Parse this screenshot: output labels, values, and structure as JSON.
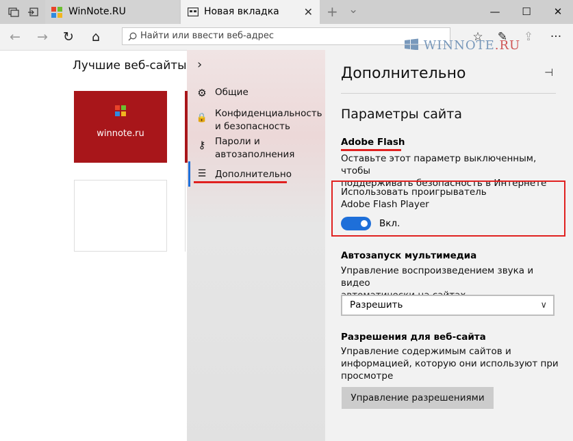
{
  "tabs": [
    {
      "title": "WinNote.RU",
      "close": "✕"
    },
    {
      "title": "Новая вкладка",
      "close": "✕"
    }
  ],
  "tabbar": {
    "new_tab": "+",
    "tab_list": "⌄"
  },
  "window": {
    "minimize": "—",
    "maximize": "☐",
    "close": "✕"
  },
  "toolbar": {
    "back": "←",
    "forward": "→",
    "refresh": "↻",
    "home": "⌂",
    "address_placeholder": "Найти или ввести веб-адрес",
    "favorites": "☆",
    "notes": "✎",
    "share": "⇪",
    "more": "···"
  },
  "watermark": {
    "main": "WINNOTE",
    "suffix": ".RU"
  },
  "top_sites": {
    "title": "Лучшие веб-сайты",
    "tiles": [
      {
        "name": "winnote.ru"
      }
    ],
    "accent": "#a8161a"
  },
  "settings_menu": {
    "chevron": "›",
    "items": [
      {
        "icon": "⚙",
        "label": "Общие"
      },
      {
        "icon": "🔒",
        "label": "Конфиденциальность и безопасность"
      },
      {
        "icon": "⚷",
        "label": "Пароли и автозаполнения"
      },
      {
        "icon": "☰",
        "label": "Дополнительно"
      }
    ]
  },
  "panel": {
    "title": "Дополнительно",
    "pin": "⊣",
    "section_title": "Параметры сайта",
    "flash": {
      "heading": "Adobe Flash",
      "desc_line1": "Оставьте этот параметр выключенным, чтобы",
      "desc_line2": "поддерживать безопасность в Интернете",
      "option_line1": "Использовать проигрыватель",
      "option_line2": "Adobe Flash Player",
      "toggle_on": true,
      "toggle_state": "Вкл."
    },
    "autoplay": {
      "heading": "Автозапуск мультимедиа",
      "desc_line1": "Управление воспроизведением звука и видео",
      "desc_line2": "автоматически на сайтах",
      "selected": "Разрешить",
      "chevron": "∨"
    },
    "permissions": {
      "heading": "Разрешения для веб-сайта",
      "desc_line1": "Управление содержимым сайтов и",
      "desc_line2": "информацией, которую они используют при",
      "desc_line3": "просмотре",
      "button": "Управление разрешениями"
    }
  },
  "colors": {
    "highlight": "#e0201f",
    "toggle": "#1e6fd9"
  }
}
